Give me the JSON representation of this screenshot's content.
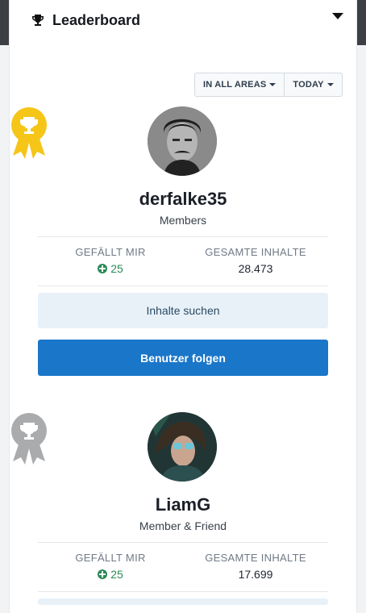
{
  "header": {
    "title": "Leaderboard"
  },
  "filters": {
    "area_label": "IN ALL AREAS",
    "time_label": "TODAY"
  },
  "entries": [
    {
      "rank": 1,
      "username": "derfalke35",
      "group": "Members",
      "likes_label": "GEFÄLLT MIR",
      "likes_value": "25",
      "content_label": "GESAMTE INHALTE",
      "content_value": "28.473",
      "find_content_label": "Inhalte suchen",
      "follow_label": "Benutzer folgen",
      "badge_color": "#f5c518"
    },
    {
      "rank": 2,
      "username": "LiamG",
      "group": "Member & Friend",
      "likes_label": "GEFÄLLT MIR",
      "likes_value": "25",
      "content_label": "GESAMTE INHALTE",
      "content_value": "17.699",
      "badge_color": "#a9abad"
    }
  ],
  "colors": {
    "primary": "#1a76c9",
    "positive": "#2b8a57",
    "light_button": "#e8f1f8"
  }
}
